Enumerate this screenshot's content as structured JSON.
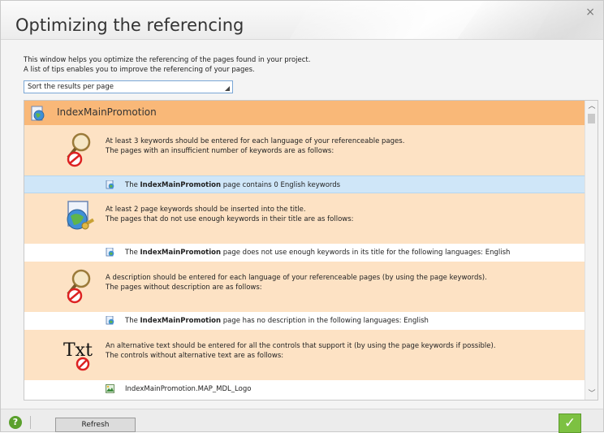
{
  "window": {
    "title": "Optimizing the referencing",
    "close_glyph": "×"
  },
  "description": {
    "line1": "This window helps you optimize the referencing of the pages found in your project.",
    "line2": "A list of tips enables you to improve the referencing of your pages."
  },
  "sort_select": {
    "value": "Sort the results per page"
  },
  "group": {
    "title": "IndexMainPromotion",
    "icon": "globe-page-icon"
  },
  "rules": [
    {
      "icon": "magnifier-no-icon",
      "line1": "At least 3 keywords should be entered for each language of your referenceable pages.",
      "line2": "The pages with an insufficient number of keywords are as follows:",
      "item": {
        "prefix": "The ",
        "page": "IndexMainPromotion",
        "suffix": " page contains 0 English keywords",
        "icon": "page-icon"
      }
    },
    {
      "icon": "globe-key-icon",
      "line1": "At least 2 page keywords should be inserted into the title.",
      "line2": "The pages that do not use enough keywords in their title are as follows:",
      "item": {
        "prefix": "The ",
        "page": "IndexMainPromotion",
        "suffix": " page does not use enough keywords in its title for the following languages: English",
        "icon": "page-icon"
      }
    },
    {
      "icon": "magnifier-no-icon",
      "line1": "A description should be entered for each language of your referenceable pages (by using the page keywords).",
      "line2": "The pages without description are as follows:",
      "item": {
        "prefix": "The ",
        "page": "IndexMainPromotion",
        "suffix": " page has no description in the following languages: English",
        "icon": "page-icon"
      }
    },
    {
      "icon": "txt-no-icon",
      "icon_text": "Txt",
      "line1": "An alternative text should be entered for all the controls that support it (by using the page keywords if possible).",
      "line2": "The controls without alternative text are as follows:",
      "item": {
        "text": "IndexMainPromotion.MAP_MDL_Logo",
        "icon": "image-control-icon"
      }
    }
  ],
  "footer": {
    "help_glyph": "?",
    "refresh_label": "Refresh",
    "ok_glyph": "✓"
  },
  "colors": {
    "group_header": "#f9b878",
    "rule_bg": "#fde2c4",
    "selected_row": "#cfe6f8",
    "ok_green": "#7dc142"
  }
}
